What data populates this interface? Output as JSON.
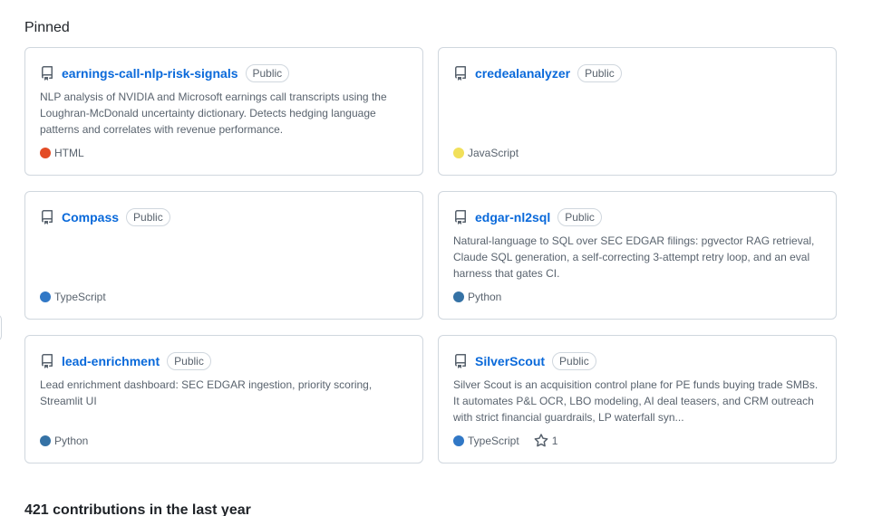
{
  "pinned": {
    "title": "Pinned",
    "repos": [
      {
        "name": "earnings-call-nlp-risk-signals",
        "visibility": "Public",
        "description": "NLP analysis of NVIDIA and Microsoft earnings call transcripts using the Loughran-McDonald uncertainty dictionary. Detects hedging language patterns and correlates with revenue performance.",
        "language": "HTML",
        "language_color": "#e34c26"
      },
      {
        "name": "credealanalyzer",
        "visibility": "Public",
        "description": "",
        "language": "JavaScript",
        "language_color": "#f1e05a"
      },
      {
        "name": "Compass",
        "visibility": "Public",
        "description": "",
        "language": "TypeScript",
        "language_color": "#3178c6"
      },
      {
        "name": "edgar-nl2sql",
        "visibility": "Public",
        "description": "Natural-language to SQL over SEC EDGAR filings: pgvector RAG retrieval, Claude SQL generation, a self-correcting 3-attempt retry loop, and an eval harness that gates CI.",
        "language": "Python",
        "language_color": "#3572A5"
      },
      {
        "name": "lead-enrichment",
        "visibility": "Public",
        "description": "Lead enrichment dashboard: SEC EDGAR ingestion, priority scoring, Streamlit UI",
        "language": "Python",
        "language_color": "#3572A5"
      },
      {
        "name": "SilverScout",
        "visibility": "Public",
        "description": "Silver Scout is an acquisition control plane for PE funds buying trade SMBs. It automates P&L OCR, LBO modeling, AI deal teasers, and CRM outreach with strict financial guardrails, LP waterfall syn...",
        "language": "TypeScript",
        "language_color": "#3178c6",
        "stars": "1"
      }
    ]
  },
  "contributions": {
    "summary": "421 contributions in the last year"
  }
}
